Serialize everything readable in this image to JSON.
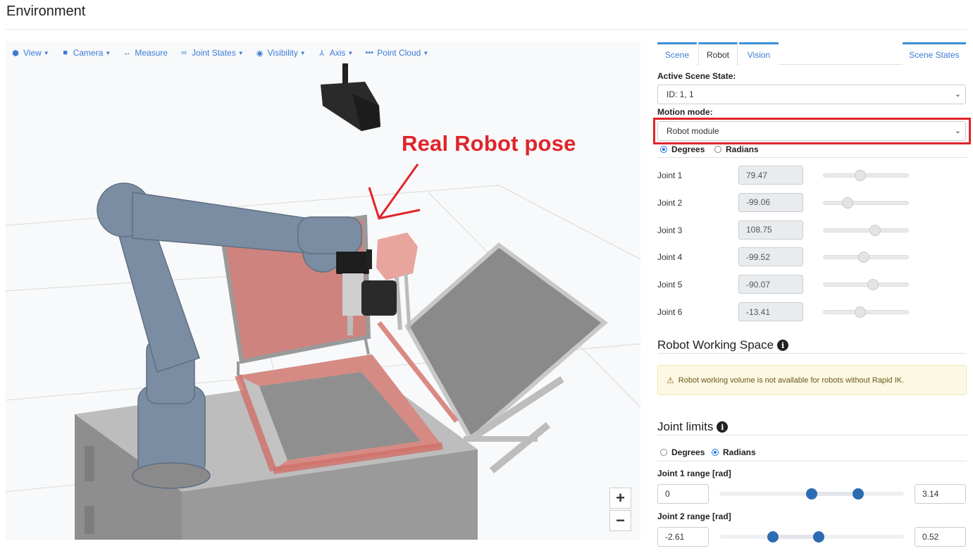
{
  "page": {
    "title": "Environment"
  },
  "toolbar": {
    "items": [
      {
        "label": "View",
        "icon": "cube-icon",
        "dropdown": true
      },
      {
        "label": "Camera",
        "icon": "video-camera-icon",
        "dropdown": true
      },
      {
        "label": "Measure",
        "icon": "arrows-horizontal-icon",
        "dropdown": false
      },
      {
        "label": "Joint States",
        "icon": "link-icon",
        "dropdown": true
      },
      {
        "label": "Visibility",
        "icon": "eye-icon",
        "dropdown": true
      },
      {
        "label": "Axis",
        "icon": "axis-icon",
        "dropdown": true
      },
      {
        "label": "Point Cloud",
        "icon": "dots-icon",
        "dropdown": true
      }
    ]
  },
  "viewer": {
    "annotation": "Real Robot pose",
    "zoom_in": "+",
    "zoom_out": "−",
    "colors": {
      "robot": "#7b8da3",
      "ghost": "#e07b74",
      "frame": "#b5b5b5",
      "floor_grid": "#d9d9d9"
    }
  },
  "tabs": {
    "scene": "Scene",
    "robot": "Robot",
    "vision": "Vision",
    "scene_states": "Scene States"
  },
  "robot_tab": {
    "active_scene_state_label": "Active Scene State:",
    "active_scene_state_value": "ID: 1, 1",
    "motion_mode_label": "Motion mode:",
    "motion_mode_value": "Robot module",
    "units": {
      "degrees": "Degrees",
      "radians": "Radians",
      "selected": "Degrees"
    },
    "joints": [
      {
        "label": "Joint 1",
        "value": "79.47",
        "slider_fraction": 0.43
      },
      {
        "label": "Joint 2",
        "value": "-99.06",
        "slider_fraction": 0.28
      },
      {
        "label": "Joint 3",
        "value": "108.75",
        "slider_fraction": 0.6
      },
      {
        "label": "Joint 4",
        "value": "-99.52",
        "slider_fraction": 0.47
      },
      {
        "label": "Joint 5",
        "value": "-90.07",
        "slider_fraction": 0.57
      },
      {
        "label": "Joint 6",
        "value": "-13.41",
        "slider_fraction": 0.43
      }
    ],
    "working_space_title": "Robot Working Space",
    "working_space_warning": "Robot working volume is not available for robots without Rapid IK.",
    "joint_limits_title": "Joint limits",
    "limits_units": {
      "degrees": "Degrees",
      "radians": "Radians",
      "selected": "Radians"
    },
    "ranges": [
      {
        "label": "Joint 1 range [rad]",
        "min": "0",
        "max": "3.14",
        "low_fraction": 0.5,
        "high_fraction": 0.75
      },
      {
        "label": "Joint 2 range [rad]",
        "min": "-2.61",
        "max": "0.52",
        "low_fraction": 0.29,
        "high_fraction": 0.54
      }
    ]
  },
  "accent_color": "#3b7bd6",
  "highlight_color": "#e0242b"
}
